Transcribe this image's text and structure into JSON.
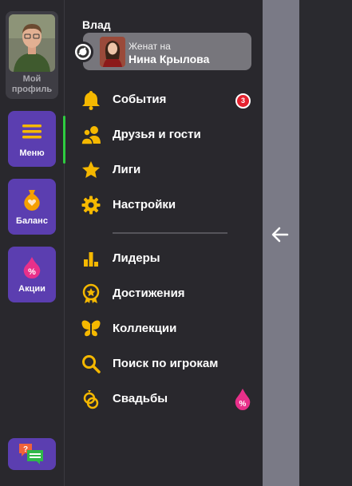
{
  "rail": {
    "profile_label": "Мой\nпрофиль",
    "menu_label": "Меню",
    "balance_label": "Баланс",
    "promos_label": "Акции"
  },
  "user": {
    "name": "Влад",
    "status_label": "Женат на",
    "spouse_name": "Нина Крылова"
  },
  "menu": {
    "events": {
      "label": "События",
      "badge": "3",
      "icon": "bell-icon"
    },
    "friends": {
      "label": "Друзья и гости",
      "icon": "friends-icon"
    },
    "leagues": {
      "label": "Лиги",
      "icon": "star-icon"
    },
    "settings": {
      "label": "Настройки",
      "icon": "gear-icon"
    },
    "leaders": {
      "label": "Лидеры",
      "icon": "bar-chart-icon"
    },
    "achievements": {
      "label": "Достижения",
      "icon": "medal-icon"
    },
    "collections": {
      "label": "Коллекции",
      "icon": "butterfly-icon"
    },
    "search": {
      "label": "Поиск по игрокам",
      "icon": "search-icon"
    },
    "weddings": {
      "label": "Свадьбы",
      "icon": "rings-icon"
    }
  },
  "colors": {
    "accent": "#5b3eb0",
    "icon_yellow": "#f5b800",
    "badge_red": "#e4222f",
    "active_green": "#2ecc40"
  }
}
